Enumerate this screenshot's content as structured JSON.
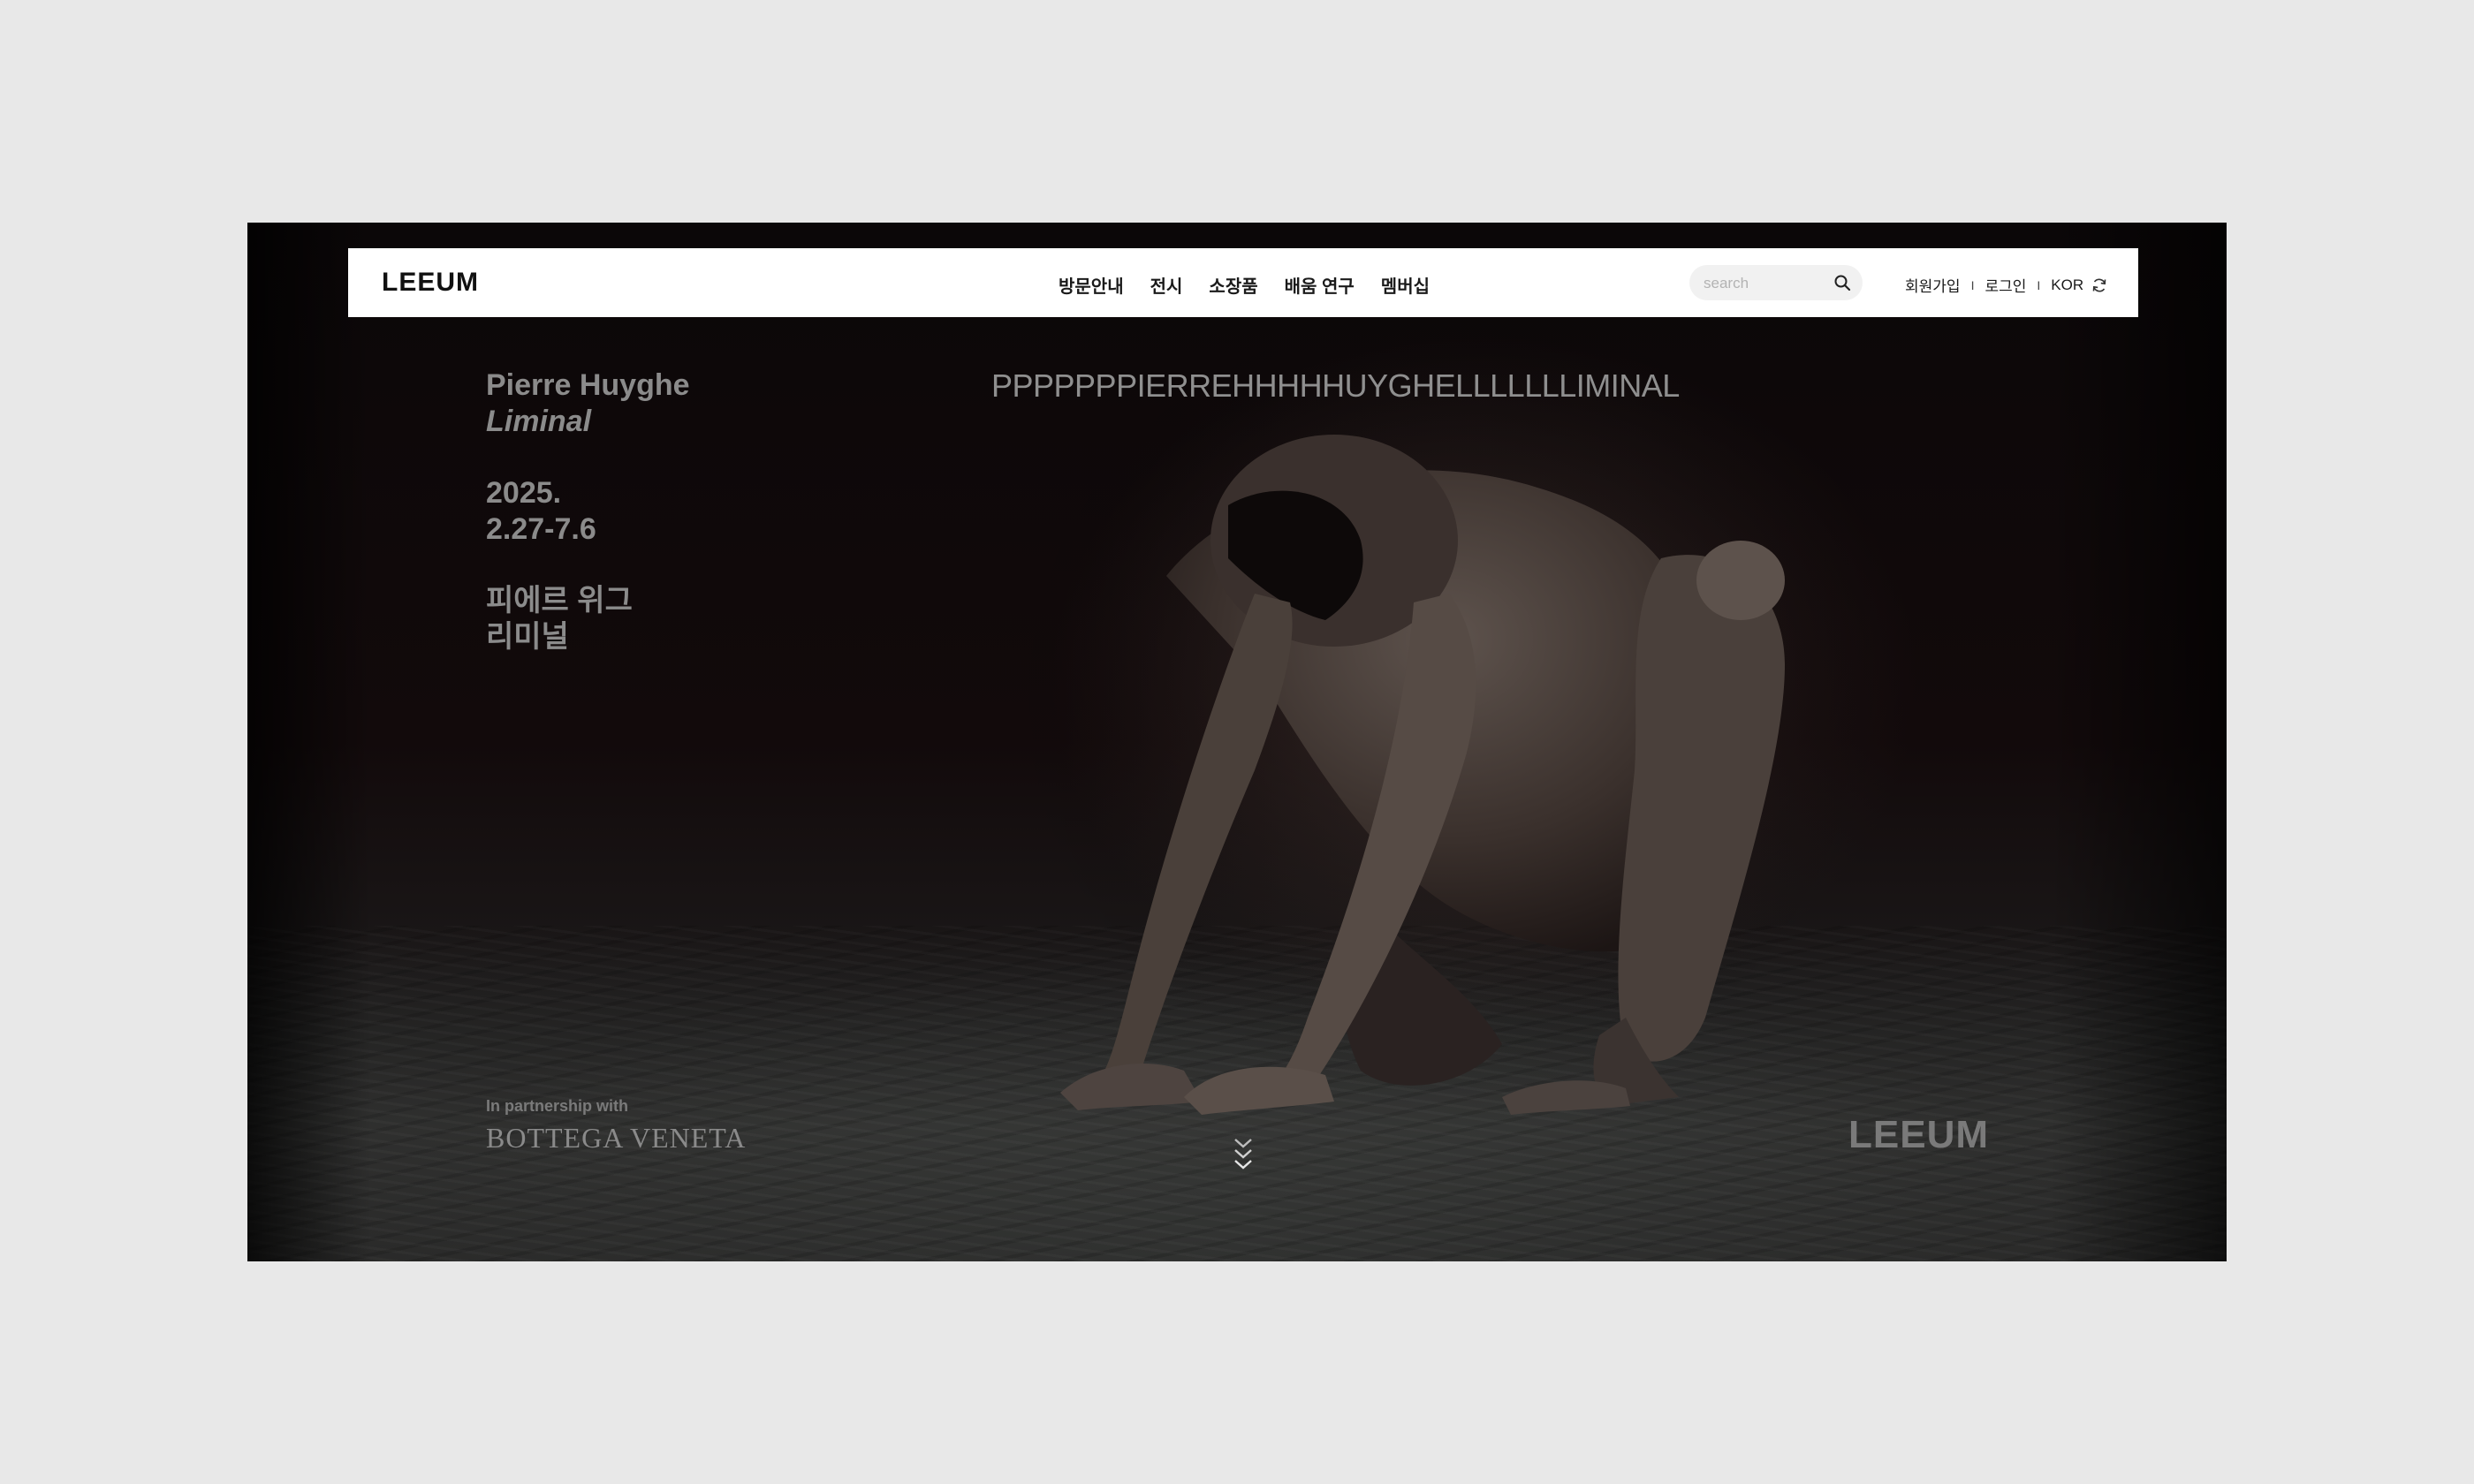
{
  "header": {
    "logo": "LEEUM",
    "nav": [
      "방문안내",
      "전시",
      "소장품",
      "배움 연구",
      "멤버십"
    ],
    "search": {
      "placeholder": "search",
      "value": ""
    },
    "utils": {
      "signup": "회원가입",
      "login": "로그인",
      "language": "KOR",
      "separator": "I"
    }
  },
  "exhibition": {
    "artist": "Pierre Huyghe",
    "title": "Liminal",
    "year": "2025.",
    "dates": "2.27-7.6",
    "artist_ko": "피에르 위그",
    "title_ko": "리미널",
    "marquee": "PPPPPPPIERREHHHHHUYGHELLLLLLLIMINAL"
  },
  "partner": {
    "label": "In partnership with",
    "brand": "BOTTEGA VENETA"
  },
  "corner_logo": "LEEUM",
  "icons": {
    "search": "search-icon",
    "refresh": "refresh-icon",
    "scroll": "chevron-down-icon"
  }
}
